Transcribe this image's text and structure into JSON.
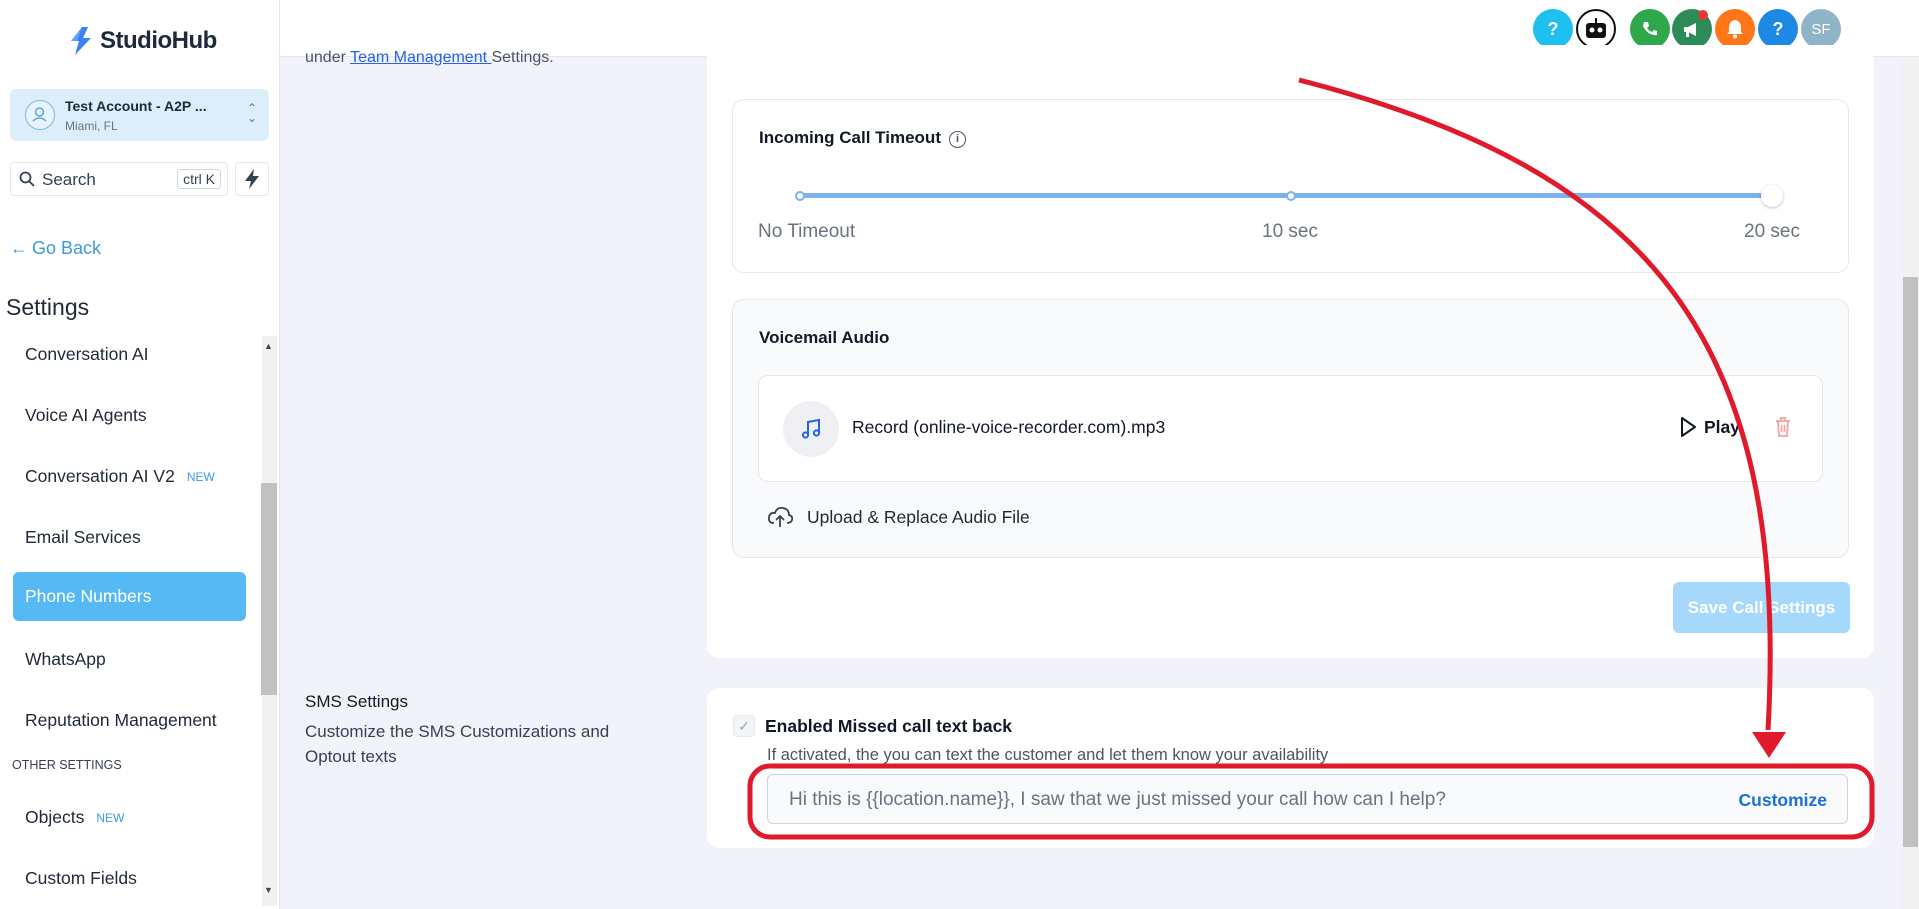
{
  "brand": {
    "name": "StudioHub"
  },
  "account": {
    "name": "Test Account - A2P ...",
    "location": "Miami, FL"
  },
  "search": {
    "label": "Search",
    "shortcut": "ctrl K"
  },
  "nav": {
    "go_back": "Go Back",
    "title": "Settings",
    "items": [
      {
        "label": "Conversation AI"
      },
      {
        "label": "Voice AI Agents"
      },
      {
        "label": "Conversation AI V2",
        "badge": "NEW"
      },
      {
        "label": "Email Services"
      },
      {
        "label": "Phone Numbers",
        "active": true
      },
      {
        "label": "WhatsApp"
      },
      {
        "label": "Reputation Management"
      }
    ],
    "section_other": "OTHER SETTINGS",
    "other_items": [
      {
        "label": "Objects",
        "badge": "NEW"
      },
      {
        "label": "Custom Fields"
      }
    ]
  },
  "topbar": {
    "icons": [
      {
        "name": "help-icon",
        "glyph": "?",
        "color": "#1ec0f0"
      },
      {
        "name": "bot-icon",
        "glyph": "",
        "color": "#111111"
      },
      {
        "name": "phone-icon",
        "glyph": "",
        "color": "#2ea84a"
      },
      {
        "name": "megaphone-icon",
        "glyph": "",
        "color": "#2e8b57"
      },
      {
        "name": "bell-icon",
        "glyph": "",
        "color": "#ff7518"
      },
      {
        "name": "question-icon",
        "glyph": "?",
        "color": "#1e88e5"
      },
      {
        "name": "avatar",
        "glyph": "SF",
        "color": "#8fb4c8"
      }
    ]
  },
  "intro": {
    "prefix": "under ",
    "link": "Team Management ",
    "suffix": "Settings."
  },
  "call_timeout": {
    "label": "Incoming Call Timeout",
    "ticks": [
      "No Timeout",
      "10 sec",
      "20 sec"
    ],
    "value": "20 sec"
  },
  "voicemail": {
    "label": "Voicemail Audio",
    "file_name": "Record (online-voice-recorder.com).mp3",
    "play_label": "Play",
    "upload_label": "Upload & Replace Audio File"
  },
  "save_button": "Save Call Settings",
  "sms": {
    "title": "SMS Settings",
    "description": "Customize the SMS Customizations and Optout texts",
    "checkbox_label": "Enabled Missed call text back",
    "checkbox_checked": true,
    "help_text": "If activated, the you can text the customer and let them know your availability",
    "message": "Hi this is {{location.name}}, I saw that we just missed your call how can I help?",
    "customize_label": "Customize"
  },
  "colors": {
    "accent": "#57b9f4",
    "link": "#3b9be0",
    "annotation": "#e01a2b"
  }
}
